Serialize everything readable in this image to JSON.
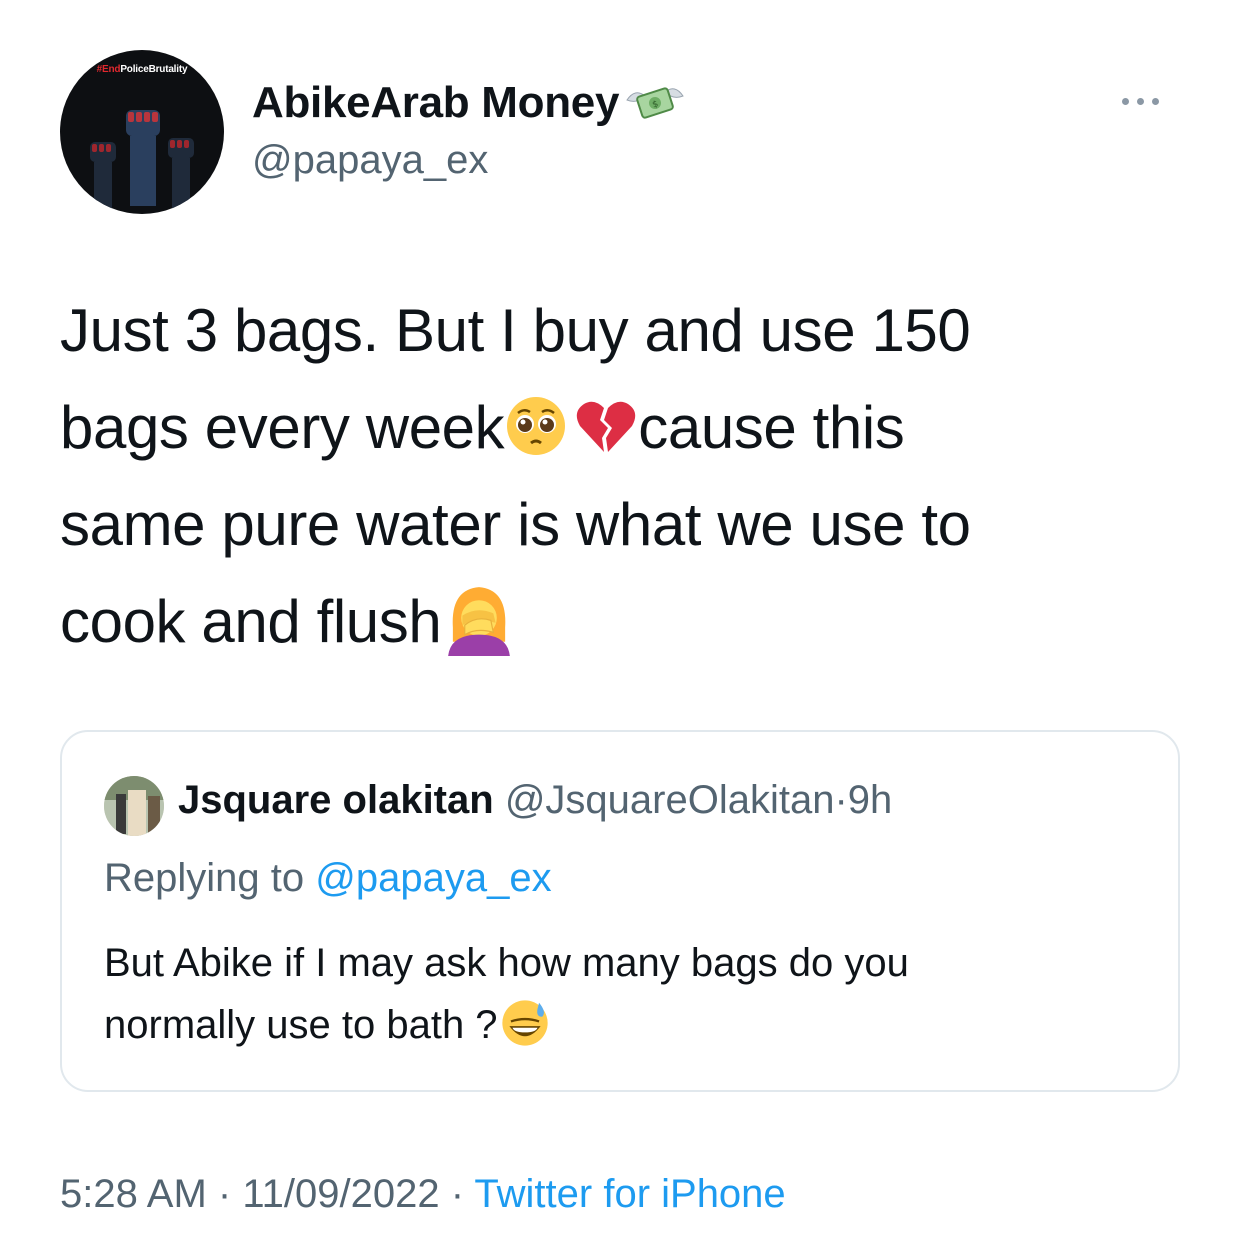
{
  "author": {
    "display_name": "AbikeArab Money",
    "handle": "@papaya_ex",
    "avatar_banner_prefix": "#End",
    "avatar_banner_rest": "PoliceBrutality",
    "name_icon": "money-with-wings-icon"
  },
  "tweet": {
    "line1": "Just 3 bags. But I buy and use 150",
    "line2_a": "bags every week",
    "line2_b": "cause this",
    "line3": "same pure water is what we use to",
    "line4": "cook and flush",
    "emojis": [
      "pleading-face-icon",
      "broken-heart-icon",
      "woman-facepalming-icon"
    ]
  },
  "quoted_tweet": {
    "name": "Jsquare olakitan",
    "handle": "@JsquareOlakitan",
    "separator": "·",
    "time": "9h",
    "replying_prefix": "Replying to",
    "replying_to": "@papaya_ex",
    "line1": "But Abike if I may ask how many bags do you",
    "line2": "normally use to bath ?",
    "emoji": "grinning-face-with-sweat-icon"
  },
  "meta": {
    "time": "5:28 AM",
    "sep": "·",
    "date": "11/09/2022",
    "source": "Twitter for iPhone"
  },
  "colors": {
    "text": "#0f1419",
    "secondary": "#536471",
    "link": "#1d9bf0",
    "border": "#e1e8ed"
  }
}
